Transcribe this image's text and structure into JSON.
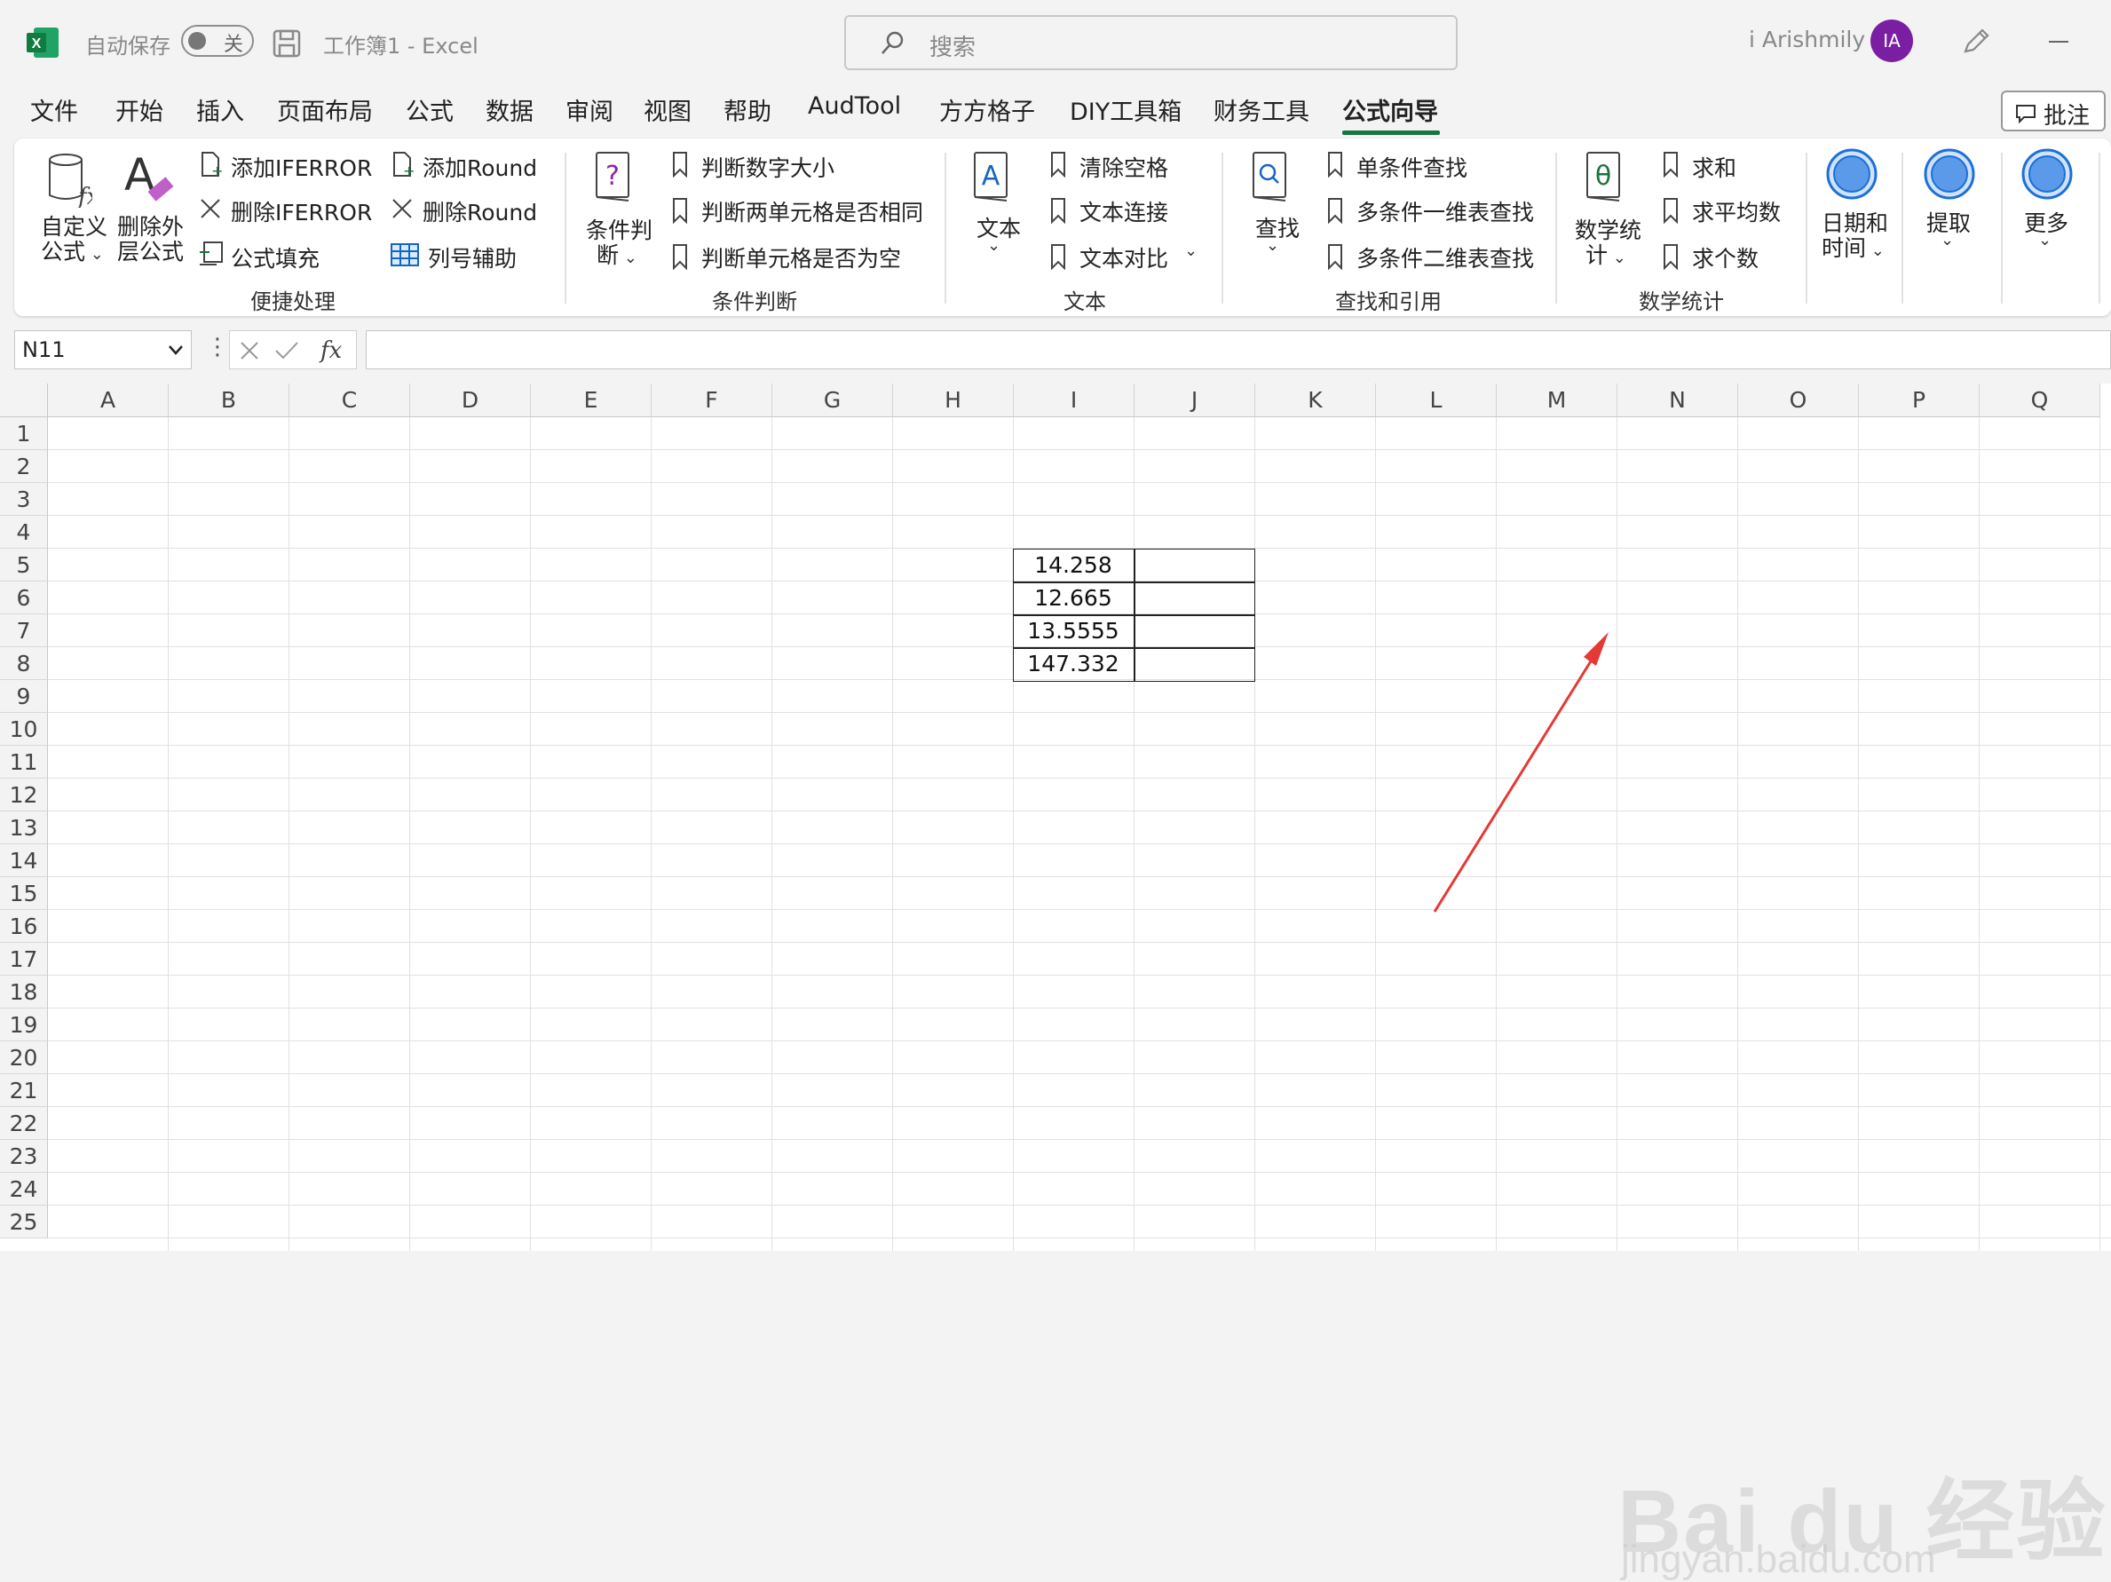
{
  "titlebar": {
    "autosave_label": "自动保存",
    "autosave_state": "关",
    "document_title": "工作簿1  -  Excel",
    "search_placeholder": "搜索",
    "user_name": "i Arishmily",
    "user_initials": "IA"
  },
  "tabs": [
    {
      "label": "文件"
    },
    {
      "label": "开始"
    },
    {
      "label": "插入"
    },
    {
      "label": "页面布局"
    },
    {
      "label": "公式"
    },
    {
      "label": "数据"
    },
    {
      "label": "审阅"
    },
    {
      "label": "视图"
    },
    {
      "label": "帮助"
    },
    {
      "label": "AudTool"
    },
    {
      "label": "方方格子"
    },
    {
      "label": "DIY工具箱"
    },
    {
      "label": "财务工具"
    },
    {
      "label": "公式向导",
      "active": true
    }
  ],
  "annotation_button": "批注",
  "ribbon": {
    "group1": {
      "label": "便捷处理",
      "custom_formula": [
        "自定义",
        "公式"
      ],
      "remove_outer": [
        "删除外",
        "层公式"
      ],
      "add_iferror": "添加IFERROR",
      "remove_iferror": "删除IFERROR",
      "formula_fill": "公式填充",
      "add_round": "添加Round",
      "remove_round": "删除Round",
      "col_helper": "列号辅助"
    },
    "group2": {
      "label": "条件判断",
      "cond_judge": [
        "条件判",
        "断"
      ],
      "judge_num": "判断数字大小",
      "judge_same": "判断两单元格是否相同",
      "judge_empty": "判断单元格是否为空"
    },
    "group3": {
      "label": "文本",
      "text": "文本",
      "clear_space": "清除空格",
      "text_join": "文本连接",
      "text_compare": "文本对比"
    },
    "group4": {
      "label": "查找和引用",
      "find": "查找",
      "single_find": "单条件查找",
      "multi_1d": "多条件一维表查找",
      "multi_2d": "多条件二维表查找"
    },
    "group5": {
      "label": "数学统计",
      "math_stat": [
        "数学统",
        "计"
      ],
      "sum": "求和",
      "average": "求平均数",
      "count": "求个数"
    },
    "datetime": [
      "日期和",
      "时间"
    ],
    "extract": "提取",
    "more": "更多"
  },
  "formula_bar": {
    "name_box": "N11",
    "formula": ""
  },
  "columns": [
    "A",
    "B",
    "C",
    "D",
    "E",
    "F",
    "G",
    "H",
    "I",
    "J",
    "K",
    "L",
    "M",
    "N",
    "O",
    "P",
    "Q"
  ],
  "rows": [
    "1",
    "2",
    "3",
    "4",
    "5",
    "6",
    "7",
    "8",
    "9",
    "10",
    "11",
    "12",
    "13",
    "14",
    "15",
    "16",
    "17",
    "18",
    "19",
    "20",
    "21",
    "22",
    "23",
    "24",
    "25"
  ],
  "cells": {
    "I5": "14.258",
    "I6": "12.665",
    "I7": "13.5555",
    "I8": "147.332"
  },
  "watermark": {
    "brand": "Bai du 经验",
    "url": "jingyan.baidu.com"
  },
  "colors": {
    "accent": "#1a7343",
    "annotation_arrow": "#e53935",
    "avatar": "#7a1fa2"
  }
}
